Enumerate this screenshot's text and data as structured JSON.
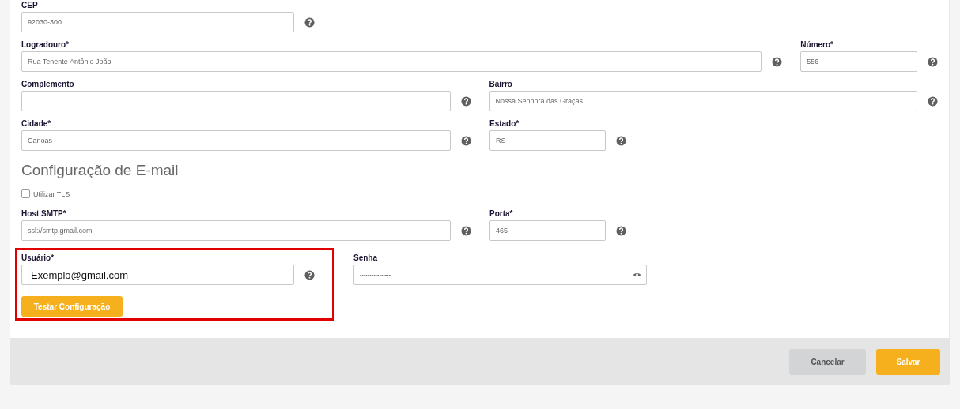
{
  "address_fields": [
    {
      "label": "CEP",
      "value": "92030-300",
      "kind": "text"
    },
    {
      "label": "Logradouro*",
      "value": "Rua Tenente Antônio João",
      "kind": "text"
    },
    {
      "label": "Número*",
      "value": "556",
      "kind": "text"
    },
    {
      "label": "Complemento",
      "kind": "text"
    },
    {
      "label": "Bairro",
      "value": "Nossa Senhora das Graças",
      "kind": "text"
    },
    {
      "label": "Cidade*",
      "value": "Canoas",
      "kind": "text"
    },
    {
      "label": "Estado*",
      "value": "RS",
      "kind": "text"
    }
  ],
  "email_section": {
    "title": "Configuração de E-mail",
    "tls_checkbox": {
      "label": "Utilizar TLS",
      "checked": false
    },
    "fields": [
      {
        "label": "Host SMTP*",
        "value": "ssl://smtp.gmail.com",
        "kind": "text"
      },
      {
        "label": "Porta*",
        "value": "465",
        "kind": "text"
      },
      {
        "label": "Usuário*",
        "value": "Exemplo@gmail.com",
        "kind": "pasted"
      },
      {
        "label": "Senha",
        "value": "••••••••••••••••",
        "kind": "password"
      }
    ],
    "test_button": "Testar Configuração"
  },
  "footer": {
    "buttons": [
      {
        "label": "Cancelar",
        "kind": "secondary"
      },
      {
        "label": "Salvar",
        "kind": "primary"
      }
    ]
  }
}
